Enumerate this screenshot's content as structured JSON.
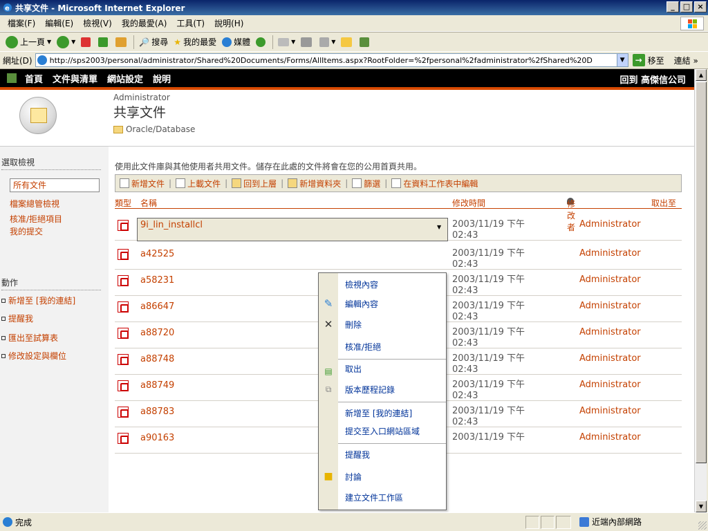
{
  "window": {
    "title": "共享文件 - Microsoft Internet Explorer",
    "buttons": [
      "_",
      "□",
      "×"
    ]
  },
  "menu": [
    "檔案(F)",
    "編輯(E)",
    "檢視(V)",
    "我的最愛(A)",
    "工具(T)",
    "說明(H)"
  ],
  "toolbar": {
    "back": "上一頁",
    "search": "搜尋",
    "favorites": "我的最愛",
    "media": "媒體"
  },
  "address": {
    "label": "網址(D)",
    "url": "http://sps2003/personal/administrator/Shared%20Documents/Forms/AllItems.aspx?RootFolder=%2fpersonal%2fadministrator%2fShared%20D",
    "go": "移至",
    "links": "連結 »"
  },
  "spnav": {
    "links": [
      "首頁",
      "文件與清單",
      "網站設定",
      "說明"
    ],
    "company": "回到 高傑信公司"
  },
  "header": {
    "user": "Administrator",
    "title": "共享文件",
    "folder": "Oracle/Database"
  },
  "leftnav": {
    "views_heading": "選取檢視",
    "views": [
      "所有文件",
      "檔案總管檢視",
      "核准/拒絕項目",
      "我的提交"
    ],
    "actions_heading": "動作",
    "actions": [
      "新增至 [我的連結]",
      "提醒我",
      "匯出至試算表",
      "修改設定與欄位"
    ]
  },
  "description": "使用此文件庫與其他使用者共用文件。儲存在此處的文件將會在您的公用首頁共用。",
  "doctoolbar": [
    "新增文件",
    "上載文件",
    "回到上層",
    "新增資料夾",
    "篩選",
    "在資料工作表中編輯"
  ],
  "columns": {
    "type": "類型",
    "name": "名稱",
    "modified": "修改時間",
    "modifiedby": "修改者",
    "checkedout": "取出至"
  },
  "rows": [
    {
      "name": "9i_lin_installcl",
      "date": "2003/11/19 下午",
      "time": "02:43",
      "by": "Administrator"
    },
    {
      "name": "a42525",
      "date": "2003/11/19 下午",
      "time": "02:43",
      "by": "Administrator"
    },
    {
      "name": "a58231",
      "date": "2003/11/19 下午",
      "time": "02:43",
      "by": "Administrator"
    },
    {
      "name": "a86647",
      "date": "2003/11/19 下午",
      "time": "02:43",
      "by": "Administrator"
    },
    {
      "name": "a88720",
      "date": "2003/11/19 下午",
      "time": "02:43",
      "by": "Administrator"
    },
    {
      "name": "a88748",
      "date": "2003/11/19 下午",
      "time": "02:43",
      "by": "Administrator"
    },
    {
      "name": "a88749",
      "date": "2003/11/19 下午",
      "time": "02:43",
      "by": "Administrator"
    },
    {
      "name": "a88783",
      "date": "2003/11/19 下午",
      "time": "02:43",
      "by": "Administrator"
    },
    {
      "name": "a90163",
      "date": "2003/11/19 下午",
      "time": "",
      "by": "Administrator"
    }
  ],
  "context_menu": [
    "檢視內容",
    "編輯內容",
    "刪除",
    "核准/拒絕",
    "取出",
    "版本歷程記錄",
    "新增至 [我的連結]",
    "提交至入口網站區域",
    "提醒我",
    "討論",
    "建立文件工作區"
  ],
  "status": {
    "text": "完成",
    "zone": "近端內部網路"
  },
  "colors": {
    "link": "#c44000",
    "nav_accent": "#d94a00",
    "titlebar": "#0a246a"
  }
}
